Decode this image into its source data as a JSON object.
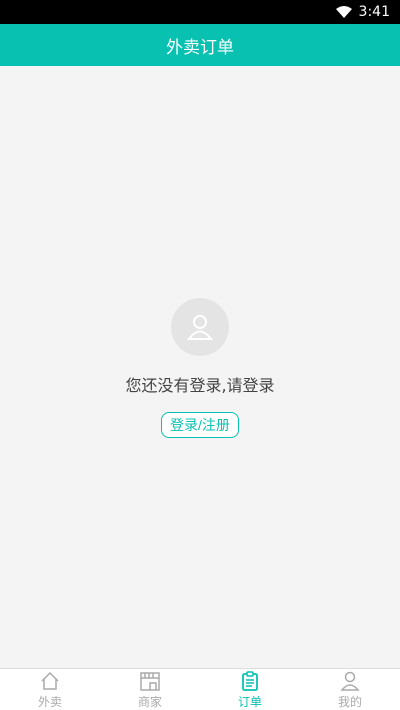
{
  "status_bar": {
    "time": "3:41",
    "icons": [
      "wifi-icon"
    ]
  },
  "header": {
    "title": "外卖订单"
  },
  "empty_state": {
    "icon": "user-avatar-icon",
    "message": "您还没有登录,请登录",
    "button_label": "登录/注册"
  },
  "tabs": [
    {
      "label": "外卖",
      "icon": "home-icon",
      "active": false
    },
    {
      "label": "商家",
      "icon": "store-icon",
      "active": false
    },
    {
      "label": "订单",
      "icon": "clipboard-icon",
      "active": true
    },
    {
      "label": "我的",
      "icon": "user-icon",
      "active": false
    }
  ],
  "colors": {
    "accent": "#09c1b0",
    "inactive": "#aaaaaa",
    "background": "#f4f4f4"
  }
}
